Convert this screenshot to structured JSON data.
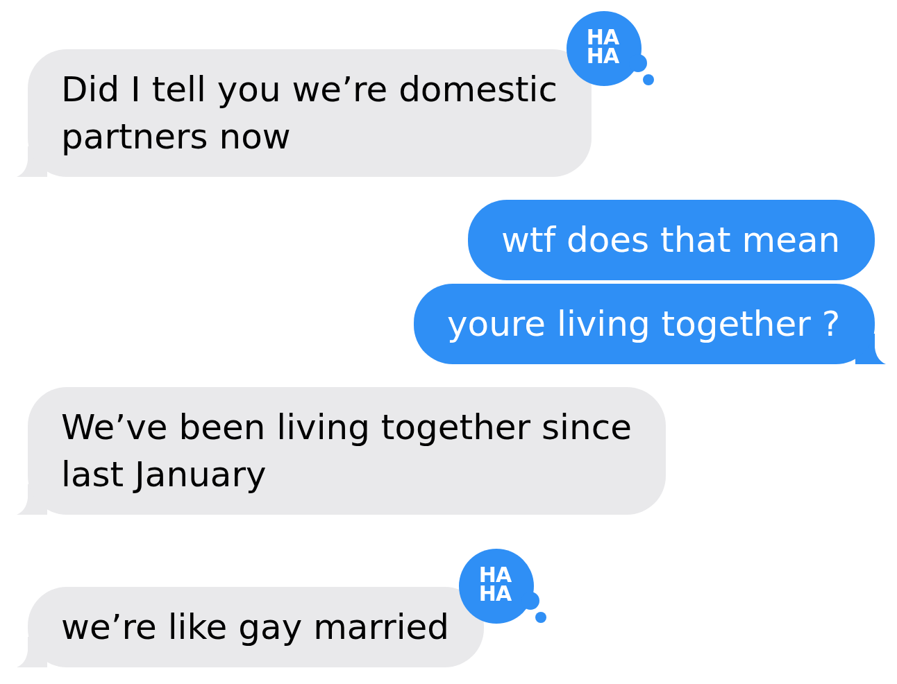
{
  "messages": [
    {
      "kind": "received",
      "text": "Did I tell you we’re domestic partners now",
      "tail": true,
      "reaction": {
        "label": "HA HA"
      }
    },
    {
      "kind": "sent",
      "text": "wtf does that mean",
      "tail": false
    },
    {
      "kind": "sent",
      "text": "youre living together ?",
      "tail": true
    },
    {
      "kind": "received",
      "text": "We’ve been living together since last January",
      "tail": true
    },
    {
      "kind": "received",
      "text": "we’re like gay married",
      "tail": true,
      "reaction": {
        "label": "HA HA"
      }
    }
  ]
}
